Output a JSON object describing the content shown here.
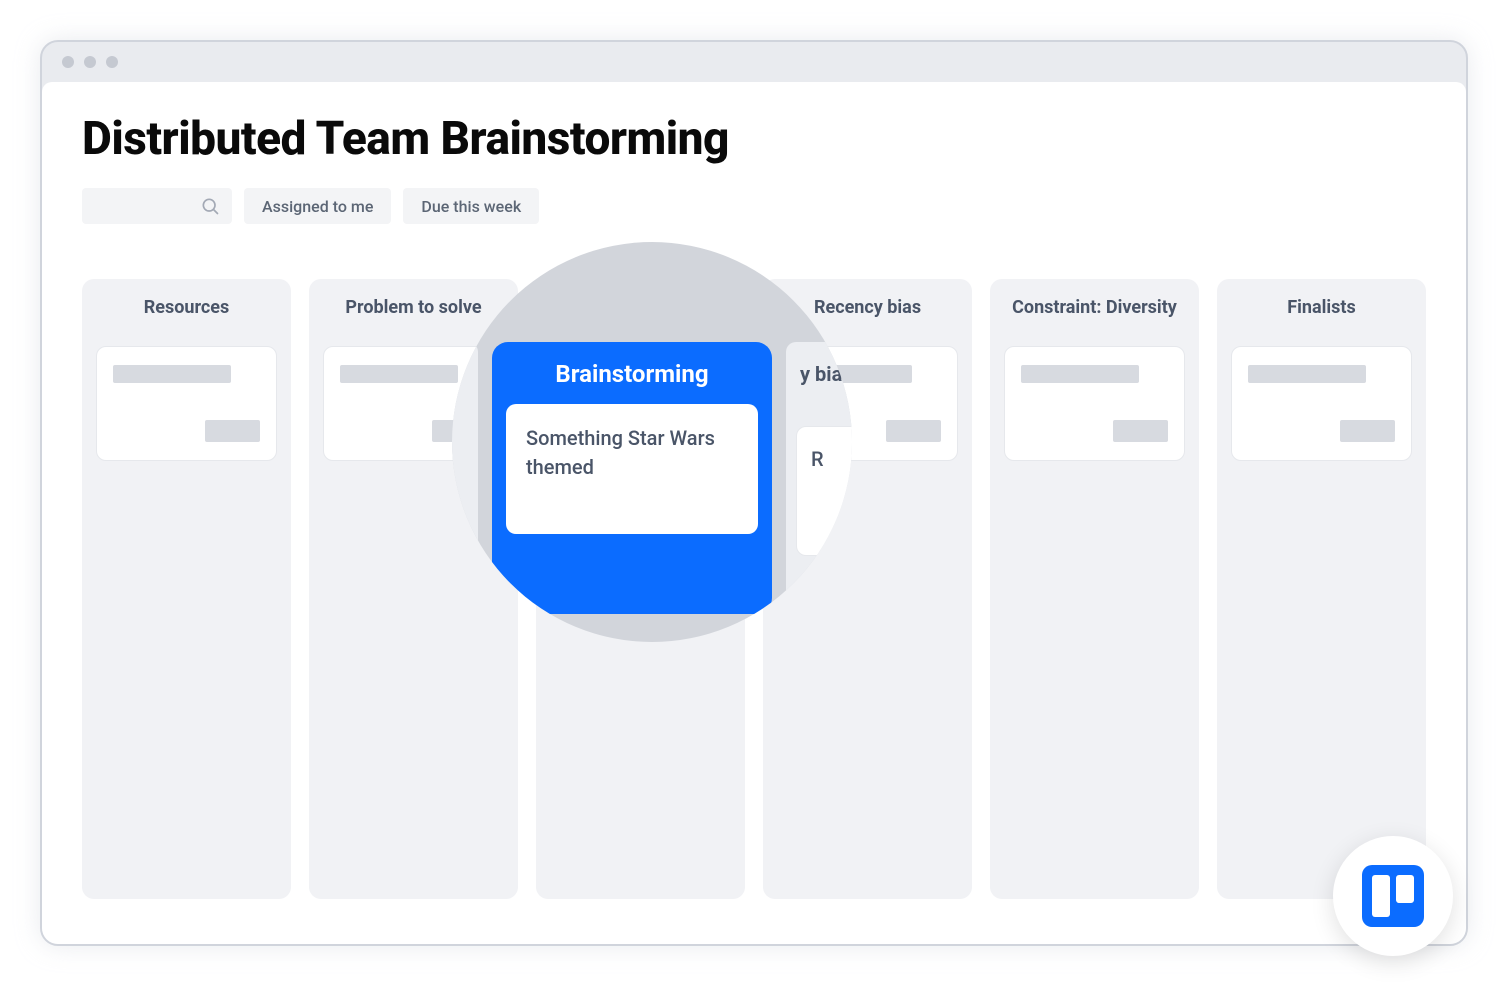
{
  "page": {
    "title": "Distributed Team Brainstorming"
  },
  "filters": {
    "assigned_label": "Assigned to me",
    "due_label": "Due this week"
  },
  "columns": [
    {
      "title": "Resources"
    },
    {
      "title": "Problem to solve"
    },
    {
      "title": "Brainstorming"
    },
    {
      "title": "Recency bias"
    },
    {
      "title": "Constraint: Diversity"
    },
    {
      "title": "Finalists"
    }
  ],
  "magnifier": {
    "column_title": "Brainstorming",
    "card_text": "Something Star Wars themed",
    "right_label_partial": "y bias",
    "right_card_partial": "R"
  },
  "brand": {
    "name": "trello",
    "accent": "#0b6CFF"
  }
}
